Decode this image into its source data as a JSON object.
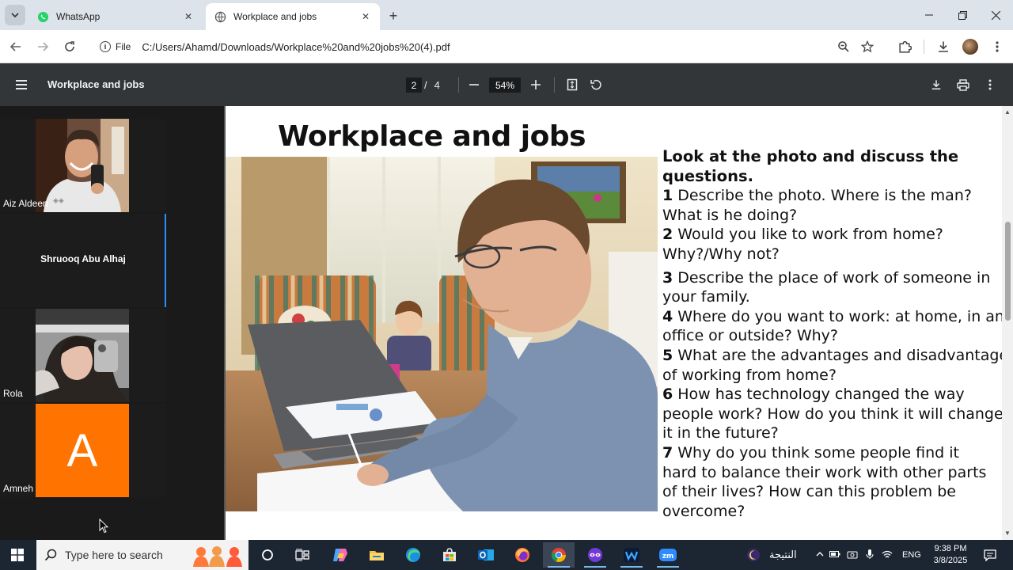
{
  "browser": {
    "tabs": [
      {
        "title": "WhatsApp",
        "active": false
      },
      {
        "title": "Workplace and jobs",
        "active": true
      }
    ],
    "address": {
      "chip_label": "File",
      "url": "C:/Users/Ahamd/Downloads/Workplace%20and%20jobs%20(4).pdf"
    }
  },
  "pdf_viewer": {
    "title": "Workplace and jobs",
    "current_page": "2",
    "total_pages": "4",
    "page_separator": "/",
    "zoom": "54%"
  },
  "participants": [
    {
      "name": "Aiz Aldeen",
      "type": "video"
    },
    {
      "name": "Shruooq Abu Alhaj",
      "type": "name-only"
    },
    {
      "name": "Rola",
      "type": "video"
    },
    {
      "name": "Amneh",
      "type": "avatar",
      "letter": "A",
      "color": "#ff7400"
    }
  ],
  "document": {
    "title": "Workplace and jobs",
    "lead": [
      "Look at the photo and discuss the",
      "questions."
    ],
    "questions": [
      {
        "num": "1",
        "lines": [
          " Describe the photo. Where is the man?",
          "What is he doing?"
        ]
      },
      {
        "num": "2",
        "lines": [
          " Would you like to work from home?",
          "Why?/Why not?"
        ]
      },
      {
        "num": "3",
        "lines": [
          " Describe the place of work of someone in",
          "your family."
        ]
      },
      {
        "num": "4",
        "lines": [
          " Where do you want to work: at home, in an",
          "office or outside? Why?"
        ]
      },
      {
        "num": "5",
        "lines": [
          " What are the advantages and disadvantages",
          "of working from home?"
        ]
      },
      {
        "num": "6",
        "lines": [
          " How has technology changed the way",
          "people work? How do you  think it will change",
          "it in the future?"
        ]
      },
      {
        "num": "7",
        "lines": [
          " Why do you think some people find it",
          "hard to balance their work with other parts",
          "of their lives? How can this problem be",
          "overcome?"
        ]
      }
    ]
  },
  "taskbar": {
    "search_placeholder": "Type here to search",
    "tray_label": "النتيجة",
    "language": "ENG",
    "time": "9:38 PM",
    "date": "3/8/2025"
  },
  "colors": {
    "pdf_toolbar": "#323639",
    "zoom_accent": "#2d8cff",
    "avatar_orange": "#ff7400",
    "taskbar": "#1c2532"
  }
}
